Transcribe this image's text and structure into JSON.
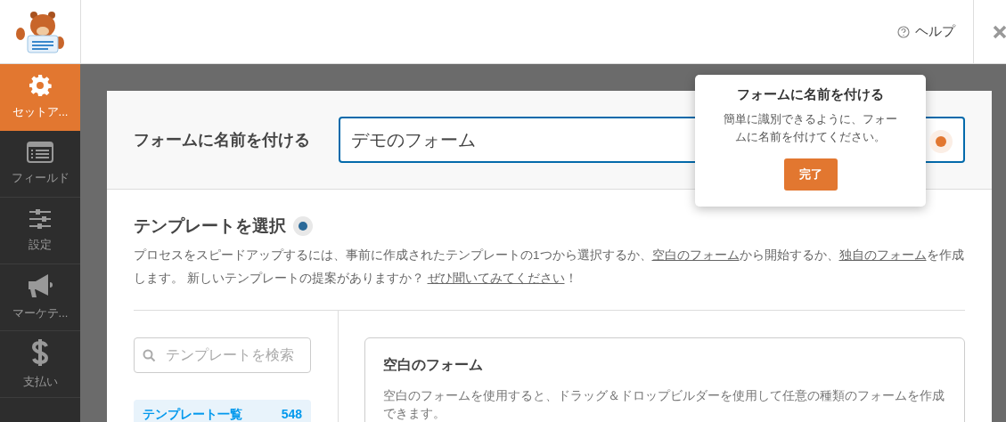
{
  "header": {
    "help": "ヘルプ"
  },
  "sidebar": {
    "items": [
      {
        "label": "セットア...",
        "selected": true
      },
      {
        "label": "フィールド",
        "selected": false
      },
      {
        "label": "設定",
        "selected": false
      },
      {
        "label": "マーケテ...",
        "selected": false
      },
      {
        "label": "支払い",
        "selected": false
      }
    ]
  },
  "name_section": {
    "label": "フォームに名前を付ける",
    "value": "デモのフォーム"
  },
  "tooltip": {
    "title": "フォームに名前を付ける",
    "text": "簡単に識別できるように、フォームに名前を付けてください。",
    "button": "完了"
  },
  "template_section": {
    "title": "テンプレートを選択",
    "description": [
      "プロセスをスピードアップするには、事前に作成されたテンプレートの1つから選択するか、",
      {
        "link": "空白のフォーム"
      },
      "から開始するか、",
      {
        "link": "独自のフォーム"
      },
      "を作成します。 新しいテンプレートの提案がありますか？ ",
      {
        "link": "ぜひ聞いてみてください"
      },
      "！"
    ],
    "search": {
      "placeholder": "テンプレートを検索"
    },
    "categories": [
      {
        "label": "テンプレート一覧",
        "count": "548",
        "selected": true
      }
    ],
    "cards": [
      {
        "title": "空白のフォーム",
        "text": "空白のフォームを使用すると、ドラッグ＆ドロップビルダーを使用して任意の種類のフォームを作成できます。"
      }
    ]
  }
}
